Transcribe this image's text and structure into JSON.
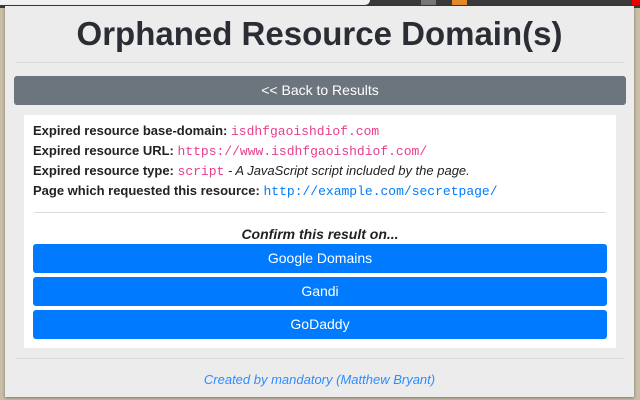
{
  "title": "Orphaned Resource Domain(s)",
  "back_button": "<< Back to Results",
  "info": {
    "base_domain_label": "Expired resource base-domain:",
    "base_domain": "isdhfgaoishdiof.com",
    "url_label": "Expired resource URL:",
    "url": "https://www.isdhfgaoishdiof.com/",
    "type_label": "Expired resource type:",
    "type": "script",
    "type_desc": " - A JavaScript script included by the page.",
    "page_label": "Page which requested this resource:",
    "page": "http://example.com/secretpage/"
  },
  "confirm_label": "Confirm this result on...",
  "registrars": [
    "Google Domains",
    "Gandi",
    "GoDaddy"
  ],
  "footer": "Created by mandatory (Matthew Bryant)",
  "colors": {
    "primary": "#007bff",
    "secondary": "#6c757d",
    "code": "#e83e8c"
  }
}
